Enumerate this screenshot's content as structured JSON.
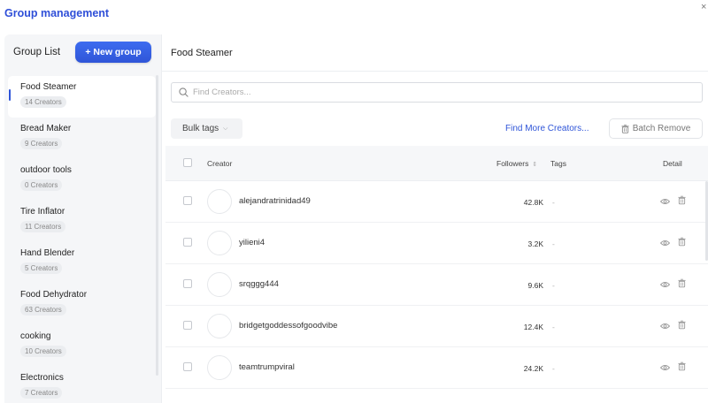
{
  "window": {
    "title": "Group management",
    "close_symbol": "×"
  },
  "sidebar": {
    "title": "Group List",
    "new_group_label": "+ New group",
    "groups": [
      {
        "name": "Food Steamer",
        "count": "14 Creators",
        "active": true
      },
      {
        "name": "Bread Maker",
        "count": "9 Creators"
      },
      {
        "name": "outdoor tools",
        "count": "0 Creators"
      },
      {
        "name": "Tire Inflator",
        "count": "11 Creators"
      },
      {
        "name": "Hand Blender",
        "count": "5 Creators"
      },
      {
        "name": "Food Dehydrator",
        "count": "63 Creators"
      },
      {
        "name": "cooking",
        "count": "10 Creators"
      },
      {
        "name": "Electronics",
        "count": "7 Creators"
      }
    ]
  },
  "main": {
    "title": "Food Steamer",
    "search_placeholder": "Find Creators...",
    "bulk_tags_label": "Bulk tags",
    "find_more_label": "Find More Creators...",
    "batch_remove_label": "Batch Remove",
    "columns": {
      "creator": "Creator",
      "followers": "Followers",
      "tags": "Tags",
      "detail": "Detail"
    },
    "rows": [
      {
        "name": "alejandratrinidad49",
        "followers": "42.8K",
        "tags": "-"
      },
      {
        "name": "yilieni4",
        "followers": "3.2K",
        "tags": "-"
      },
      {
        "name": "srqggg444",
        "followers": "9.6K",
        "tags": "-"
      },
      {
        "name": "bridgetgoddessofgoodvibe",
        "followers": "12.4K",
        "tags": "-"
      },
      {
        "name": "teamtrumpviral",
        "followers": "24.2K",
        "tags": "-"
      }
    ]
  },
  "colors": {
    "accent": "#2f55d8",
    "title": "#2f4fd8",
    "sidebar_bg": "#f5f6f8"
  },
  "icons": [
    "close-icon",
    "search-icon",
    "chevron-down-icon",
    "trash-icon",
    "sort-icon",
    "eye-icon"
  ]
}
